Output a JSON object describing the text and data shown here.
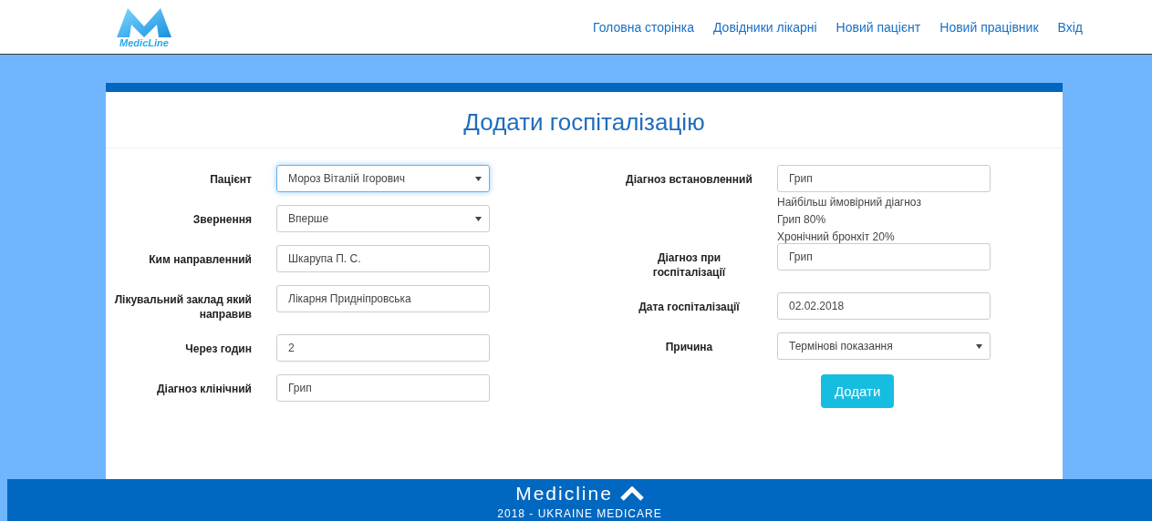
{
  "header": {
    "logo_text": "MedicLine",
    "nav": [
      {
        "label": "Головна сторінка"
      },
      {
        "label": "Довідники лікарні"
      },
      {
        "label": "Новий пацієнт"
      },
      {
        "label": "Новий працівник"
      },
      {
        "label": "Вхід"
      }
    ]
  },
  "form": {
    "title": "Додати госпіталізацію",
    "left_fields": [
      {
        "label": "Пацієнт",
        "kind": "select",
        "value": "Мороз Віталій Ігорович",
        "focused": true
      },
      {
        "label": "Звернення",
        "kind": "select",
        "value": "Вперше",
        "focused": false
      },
      {
        "label": "Ким направленний",
        "kind": "input",
        "value": "Шкарупа П. С.",
        "focused": false
      },
      {
        "label": "Лікувальний заклад який направив",
        "kind": "input",
        "value": "Лікарня Придніпровська",
        "focused": false
      },
      {
        "label": "Через годин",
        "kind": "input",
        "value": "2",
        "focused": false
      },
      {
        "label": "Діагноз клінічний",
        "kind": "input",
        "value": "Грип",
        "focused": false
      }
    ],
    "right_fields": [
      {
        "label": "Діагноз встановленний",
        "kind": "input",
        "value": "Грип",
        "focused": false
      },
      {
        "kind": "hint",
        "lines": [
          "Найбільш ймовірний діагноз",
          "Грип 80%",
          "Хронічний бронхіт 20%"
        ]
      },
      {
        "label": "Діагноз при госпіталізації",
        "kind": "input",
        "value": "Грип",
        "focused": false
      },
      {
        "label": "Дата госпіталізації",
        "kind": "input",
        "value": "02.02.2018",
        "focused": false
      },
      {
        "label": "Причина",
        "kind": "select",
        "value": "Термінові показання",
        "focused": false
      }
    ],
    "submit": "Додати"
  },
  "footer": {
    "brand": "Medicline",
    "tagline": "2018 - UKRAINE MEDICARE"
  }
}
